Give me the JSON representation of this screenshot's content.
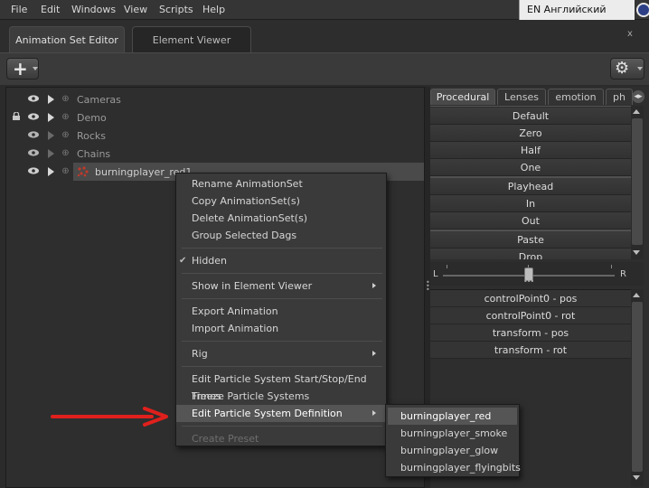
{
  "menubar": {
    "items": [
      "File",
      "Edit",
      "Windows",
      "View",
      "Scripts",
      "Help"
    ],
    "language": "EN Английский (США)"
  },
  "tabs": [
    {
      "label": "Animation Set Editor",
      "active": true
    },
    {
      "label": "Element Viewer",
      "active": false
    }
  ],
  "close_label": "x",
  "tree": {
    "items": [
      {
        "label": "Cameras",
        "locked": false,
        "visible": true
      },
      {
        "label": "Demo",
        "locked": true,
        "visible": true
      },
      {
        "label": "Rocks",
        "locked": false,
        "visible": true
      },
      {
        "label": "Chains",
        "locked": false,
        "visible": true
      },
      {
        "label": "burningplayer_red1",
        "locked": false,
        "visible": true,
        "selected": true
      }
    ]
  },
  "right_panel": {
    "tabs": [
      "Procedural",
      "Lenses",
      "emotion",
      "ph"
    ],
    "presets": [
      "Default",
      "Zero",
      "Half",
      "One",
      "Playhead",
      "In",
      "Out",
      "Paste",
      "Drop"
    ],
    "slider": {
      "left_label": "L",
      "right_label": "R",
      "value": 0.5
    },
    "attributes": [
      "controlPoint0 - pos",
      "controlPoint0 - rot",
      "transform - pos",
      "transform - rot"
    ]
  },
  "context_menu": {
    "items": [
      {
        "label": "Rename AnimationSet"
      },
      {
        "label": "Copy AnimationSet(s)"
      },
      {
        "label": "Delete AnimationSet(s)"
      },
      {
        "label": "Group Selected Dags"
      },
      {
        "label": "Hidden",
        "checked": true
      },
      {
        "label": "Show in Element Viewer",
        "submenu": true
      },
      {
        "label": "Export Animation"
      },
      {
        "label": "Import Animation"
      },
      {
        "label": "Rig",
        "submenu": true
      },
      {
        "label": "Edit Particle System Start/Stop/End Times"
      },
      {
        "label": "Freeze Particle Systems"
      },
      {
        "label": "Edit Particle System Definition",
        "submenu": true,
        "active": true
      },
      {
        "label": "Create Preset",
        "disabled": true
      }
    ]
  },
  "submenu": {
    "items": [
      "burningplayer_red",
      "burningplayer_smoke",
      "burningplayer_glow",
      "burningplayer_flyingbits"
    ]
  },
  "colors": {
    "annotation_arrow": "#e0201c",
    "selection": "#555555",
    "background": "#2b2b2b"
  }
}
